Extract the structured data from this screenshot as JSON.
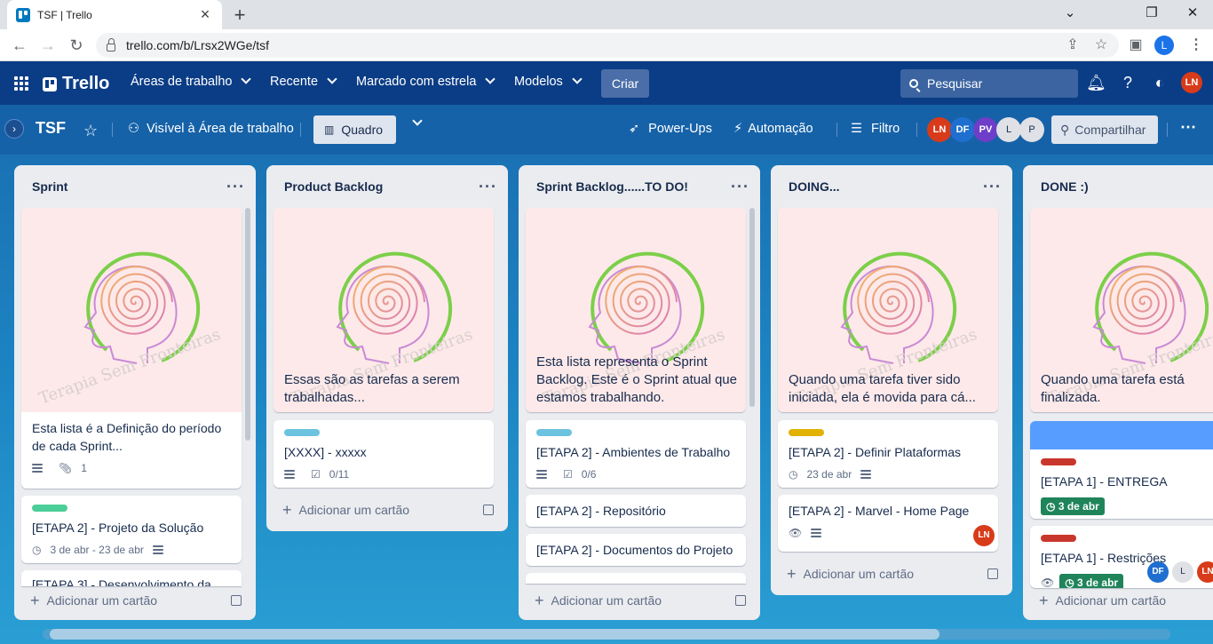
{
  "browser": {
    "tab_title": "TSF | Trello",
    "url": "trello.com/b/Lrsx2WGe/tsf",
    "profile_initial": "L"
  },
  "header": {
    "logo": "Trello",
    "nav": [
      "Áreas de trabalho",
      "Recente",
      "Marcado com estrela",
      "Modelos"
    ],
    "create_label": "Criar",
    "search_placeholder": "Pesquisar",
    "user_avatar": "LN"
  },
  "board": {
    "title": "TSF",
    "visibility": "Visível à Área de trabalho",
    "view": "Quadro",
    "powerups": "Power-Ups",
    "automation": "Automação",
    "filter": "Filtro",
    "members": [
      "LN",
      "DF",
      "PV",
      "L",
      "P"
    ],
    "share": "Compartilhar"
  },
  "cover_watermark": "Terapia Sem Fronteiras",
  "add_card_label": "Adicionar um cartão",
  "lists": [
    {
      "title": "Sprint",
      "cover_text": "Esta lista é a Definição do período de cada Sprint...",
      "cover_attachments": "1",
      "cards": [
        {
          "title": "[ETAPA 2] - Projeto da Solução",
          "date": "3 de abr - 23 de abr",
          "label_color": "#4bce97"
        },
        {
          "title": "[ETAPA 3] - Desenvolvimento da"
        }
      ]
    },
    {
      "title": "Product Backlog",
      "cover_text": "Essas são as tarefas a serem trabalhadas...",
      "cards": [
        {
          "title": "[XXXX] - xxxxx",
          "checklist": "0/11",
          "label_color": "#6cc3e0"
        }
      ]
    },
    {
      "title": "Sprint Backlog......TO DO!",
      "cover_text": "Esta lista representa o Sprint Backlog. Este é o Sprint atual que estamos trabalhando.",
      "cards": [
        {
          "title": "[ETAPA 2] - Ambientes de Trabalho",
          "checklist": "0/6",
          "label_color": "#6cc3e0"
        },
        {
          "title": "[ETAPA 2] - Repositório"
        },
        {
          "title": "[ETAPA 2] - Documentos do Projeto"
        }
      ]
    },
    {
      "title": "DOING...",
      "cover_text": "Quando uma tarefa tiver sido iniciada, ela é movida para cá...",
      "cards": [
        {
          "title": "[ETAPA 2] - Definir Plataformas",
          "date": "23 de abr",
          "label_color": "#e2b203"
        },
        {
          "title": "[ETAPA 2] - Marvel - Home Page",
          "member": "LN"
        }
      ]
    },
    {
      "title": "DONE :)",
      "cover_text": "Quando uma tarefa está finalizada.",
      "cards": [
        {
          "title": "[ETAPA 1] - ENTREGA",
          "date": "3 de abr",
          "label_color": "#c9372c"
        },
        {
          "title": "[ETAPA 1] - Restrições",
          "date": "3 de abr",
          "label_color": "#c9372c",
          "members": [
            "DF",
            "L",
            "LN"
          ]
        }
      ]
    }
  ]
}
